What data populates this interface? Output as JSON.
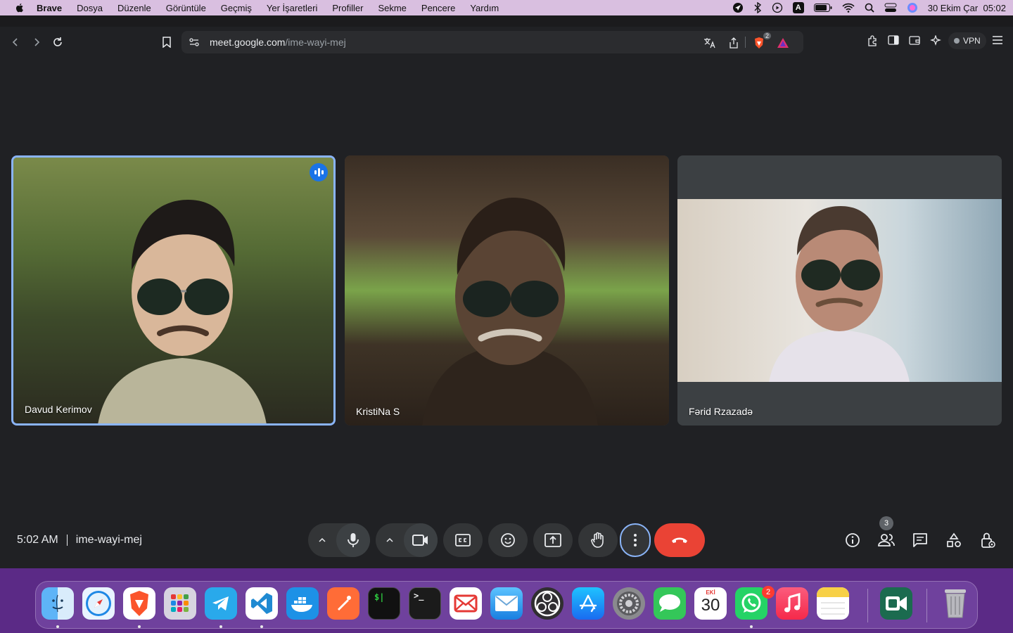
{
  "menubar": {
    "app_name": "Brave",
    "items": [
      "Dosya",
      "Düzenle",
      "Görüntüle",
      "Geçmiş",
      "Yer İşaretleri",
      "Profiller",
      "Sekme",
      "Pencere",
      "Yardım"
    ],
    "datetime": "30 Ekim Çar  05:02",
    "keyboard_input": "A"
  },
  "browser": {
    "url_host": "meet.google.com",
    "url_path": "/ime-wayi-mej",
    "shields_count": "2",
    "vpn_label": "VPN"
  },
  "meet": {
    "participants": [
      {
        "name": "Davud Kerimov",
        "speaking": true
      },
      {
        "name": "KristiNa S",
        "speaking": false
      },
      {
        "name": "Fərid Rzazadə",
        "speaking": false
      }
    ],
    "time": "5:02 AM",
    "meeting_code": "ime-wayi-mej",
    "people_count": "3"
  },
  "dock": {
    "calendar_month": "EKİ",
    "calendar_day": "30",
    "whatsapp_badge": "2",
    "apps": [
      "Finder",
      "Safari",
      "Brave",
      "Launchpad",
      "Telegram",
      "Visual Studio Code",
      "Docker",
      "Postman",
      "iTerm",
      "Terminal",
      "Airmail",
      "Mail",
      "OBS",
      "App Store",
      "System Settings",
      "Messages",
      "Calendar",
      "WhatsApp",
      "Music",
      "Notes",
      "Google Meet",
      "Trash"
    ]
  }
}
